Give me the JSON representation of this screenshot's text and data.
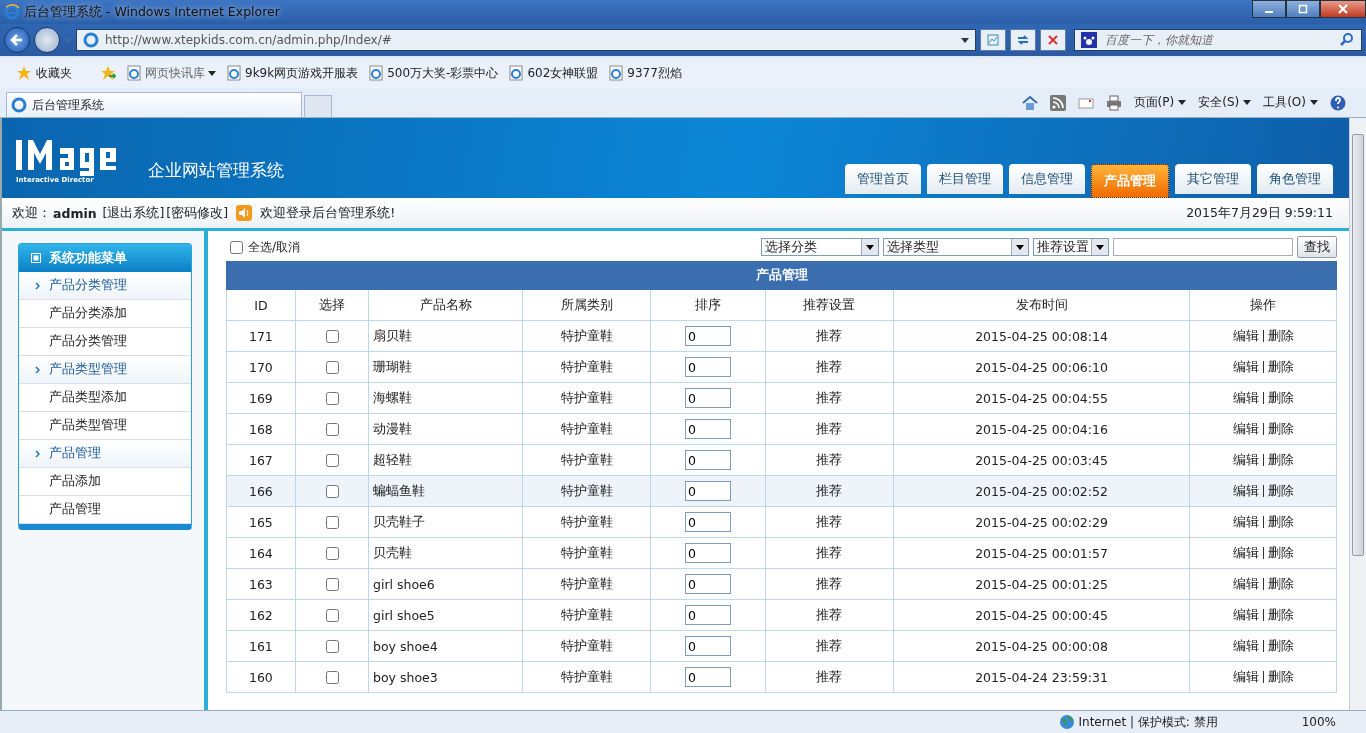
{
  "window": {
    "title": "后台管理系统 - Windows Internet Explorer"
  },
  "address_bar": {
    "url": "http://www.xtepkids.com.cn/admin.php/Index/#"
  },
  "search": {
    "placeholder": "百度一下，你就知道"
  },
  "favorites": {
    "label": "收藏夹",
    "items": [
      {
        "label": "网页快讯库",
        "kind": "dropdown"
      },
      {
        "label": "9k9k网页游戏开服表",
        "kind": "link"
      },
      {
        "label": "500万大奖-彩票中心",
        "kind": "link"
      },
      {
        "label": "602女神联盟",
        "kind": "link"
      },
      {
        "label": "9377烈焰",
        "kind": "link"
      }
    ]
  },
  "browser_tabs": [
    {
      "label": "后台管理系统",
      "selected": true
    }
  ],
  "command_bar": [
    "页面(P)",
    "安全(S)",
    "工具(O)"
  ],
  "header": {
    "logo_subtitle": "Interactive Director",
    "system_name": "企业网站管理系统",
    "nav": [
      {
        "label": "管理首页",
        "selected": false
      },
      {
        "label": "栏目管理",
        "selected": false
      },
      {
        "label": "信息管理",
        "selected": false
      },
      {
        "label": "产品管理",
        "selected": true
      },
      {
        "label": "其它管理",
        "selected": false
      },
      {
        "label": "角色管理",
        "selected": false
      }
    ]
  },
  "info_bar": {
    "welcome": "欢迎：",
    "user": "admin",
    "links": [
      "[退出系统]",
      "[密码修改]"
    ],
    "message": "欢迎登录后台管理系统!",
    "datetime": "2015年7月29日 9:59:11"
  },
  "sidebar": {
    "title": "系统功能菜单",
    "items": [
      {
        "label": "产品分类管理",
        "kind": "group"
      },
      {
        "label": "产品分类添加",
        "kind": "item"
      },
      {
        "label": "产品分类管理",
        "kind": "item"
      },
      {
        "label": "产品类型管理",
        "kind": "group"
      },
      {
        "label": "产品类型添加",
        "kind": "item"
      },
      {
        "label": "产品类型管理",
        "kind": "item"
      },
      {
        "label": "产品管理",
        "kind": "group"
      },
      {
        "label": "产品添加",
        "kind": "item"
      },
      {
        "label": "产品管理",
        "kind": "item"
      }
    ]
  },
  "filters": {
    "select_all": {
      "label": "全选/取消",
      "checked": false
    },
    "selects": [
      "选择分类",
      "选择类型",
      "推荐设置"
    ],
    "search_button": "查找"
  },
  "table": {
    "title": "产品管理",
    "columns": [
      "ID",
      "选择",
      "产品名称",
      "所属类别",
      "排序",
      "推荐设置",
      "发布时间",
      "操作"
    ],
    "rows": [
      {
        "id": "171",
        "checked": false,
        "name": "扇贝鞋",
        "category": "特护童鞋",
        "order": "0",
        "recommend": "推荐",
        "time": "2015-04-25 00:08:14",
        "highlighted": false,
        "actions": [
          "编辑",
          "删除"
        ]
      },
      {
        "id": "170",
        "checked": false,
        "name": "珊瑚鞋",
        "category": "特护童鞋",
        "order": "0",
        "recommend": "推荐",
        "time": "2015-04-25 00:06:10",
        "highlighted": false,
        "actions": [
          "编辑",
          "删除"
        ]
      },
      {
        "id": "169",
        "checked": false,
        "name": "海螺鞋",
        "category": "特护童鞋",
        "order": "0",
        "recommend": "推荐",
        "time": "2015-04-25 00:04:55",
        "highlighted": false,
        "actions": [
          "编辑",
          "删除"
        ]
      },
      {
        "id": "168",
        "checked": false,
        "name": "动漫鞋",
        "category": "特护童鞋",
        "order": "0",
        "recommend": "推荐",
        "time": "2015-04-25 00:04:16",
        "highlighted": false,
        "actions": [
          "编辑",
          "删除"
        ]
      },
      {
        "id": "167",
        "checked": false,
        "name": "超轻鞋",
        "category": "特护童鞋",
        "order": "0",
        "recommend": "推荐",
        "time": "2015-04-25 00:03:45",
        "highlighted": false,
        "actions": [
          "编辑",
          "删除"
        ]
      },
      {
        "id": "166",
        "checked": false,
        "name": "蝙蝠鱼鞋",
        "category": "特护童鞋",
        "order": "0",
        "recommend": "推荐",
        "time": "2015-04-25 00:02:52",
        "highlighted": true,
        "actions": [
          "编辑",
          "删除"
        ]
      },
      {
        "id": "165",
        "checked": false,
        "name": "贝壳鞋子",
        "category": "特护童鞋",
        "order": "0",
        "recommend": "推荐",
        "time": "2015-04-25 00:02:29",
        "highlighted": false,
        "actions": [
          "编辑",
          "删除"
        ]
      },
      {
        "id": "164",
        "checked": false,
        "name": "贝壳鞋",
        "category": "特护童鞋",
        "order": "0",
        "recommend": "推荐",
        "time": "2015-04-25 00:01:57",
        "highlighted": false,
        "actions": [
          "编辑",
          "删除"
        ]
      },
      {
        "id": "163",
        "checked": false,
        "name": "girl shoe6",
        "category": "特护童鞋",
        "order": "0",
        "recommend": "推荐",
        "time": "2015-04-25 00:01:25",
        "highlighted": false,
        "actions": [
          "编辑",
          "删除"
        ]
      },
      {
        "id": "162",
        "checked": false,
        "name": "girl shoe5",
        "category": "特护童鞋",
        "order": "0",
        "recommend": "推荐",
        "time": "2015-04-25 00:00:45",
        "highlighted": false,
        "actions": [
          "编辑",
          "删除"
        ]
      },
      {
        "id": "161",
        "checked": false,
        "name": "boy shoe4",
        "category": "特护童鞋",
        "order": "0",
        "recommend": "推荐",
        "time": "2015-04-25 00:00:08",
        "highlighted": false,
        "actions": [
          "编辑",
          "删除"
        ]
      },
      {
        "id": "160",
        "checked": false,
        "name": "boy shoe3",
        "category": "特护童鞋",
        "order": "0",
        "recommend": "推荐",
        "time": "2015-04-24 23:59:31",
        "highlighted": false,
        "actions": [
          "编辑",
          "删除"
        ]
      }
    ]
  },
  "status_bar": {
    "zone": "Internet | 保护模式: 禁用",
    "zoom": "100%"
  }
}
